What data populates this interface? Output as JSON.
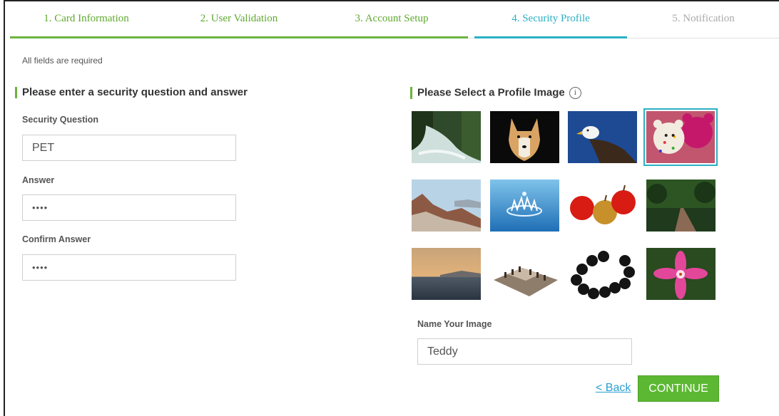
{
  "steps": [
    {
      "label": "1. Card Information",
      "state": "done"
    },
    {
      "label": "2. User Validation",
      "state": "done"
    },
    {
      "label": "3. Account Setup",
      "state": "done"
    },
    {
      "label": "4. Security Profile",
      "state": "active"
    },
    {
      "label": "5. Notification",
      "state": "todo"
    }
  ],
  "required_note": "All fields are required",
  "security": {
    "title": "Please enter a security question and answer",
    "question_label": "Security Question",
    "question_value": "PET",
    "answer_label": "Answer",
    "answer_value": "••••",
    "confirm_label": "Confirm Answer",
    "confirm_value": "••••"
  },
  "profile": {
    "title": "Please Select a Profile Image",
    "info_glyph": "i",
    "images": [
      {
        "name": "waterfall-image"
      },
      {
        "name": "dog-image"
      },
      {
        "name": "eagle-image"
      },
      {
        "name": "teddy-bears-image",
        "selected": true
      },
      {
        "name": "rock-landscape-image"
      },
      {
        "name": "water-splash-image"
      },
      {
        "name": "apples-image"
      },
      {
        "name": "forest-path-image"
      },
      {
        "name": "sunset-sea-image"
      },
      {
        "name": "chessboard-image"
      },
      {
        "name": "bead-necklace-image"
      },
      {
        "name": "lily-flower-image"
      }
    ],
    "name_label": "Name Your Image",
    "name_value": "Teddy"
  },
  "actions": {
    "back_label": "< Back",
    "continue_label": "CONTINUE"
  },
  "colors": {
    "accent_green": "#6cb33f",
    "active_teal": "#2ab0c4",
    "link_blue": "#2a9fcf"
  }
}
